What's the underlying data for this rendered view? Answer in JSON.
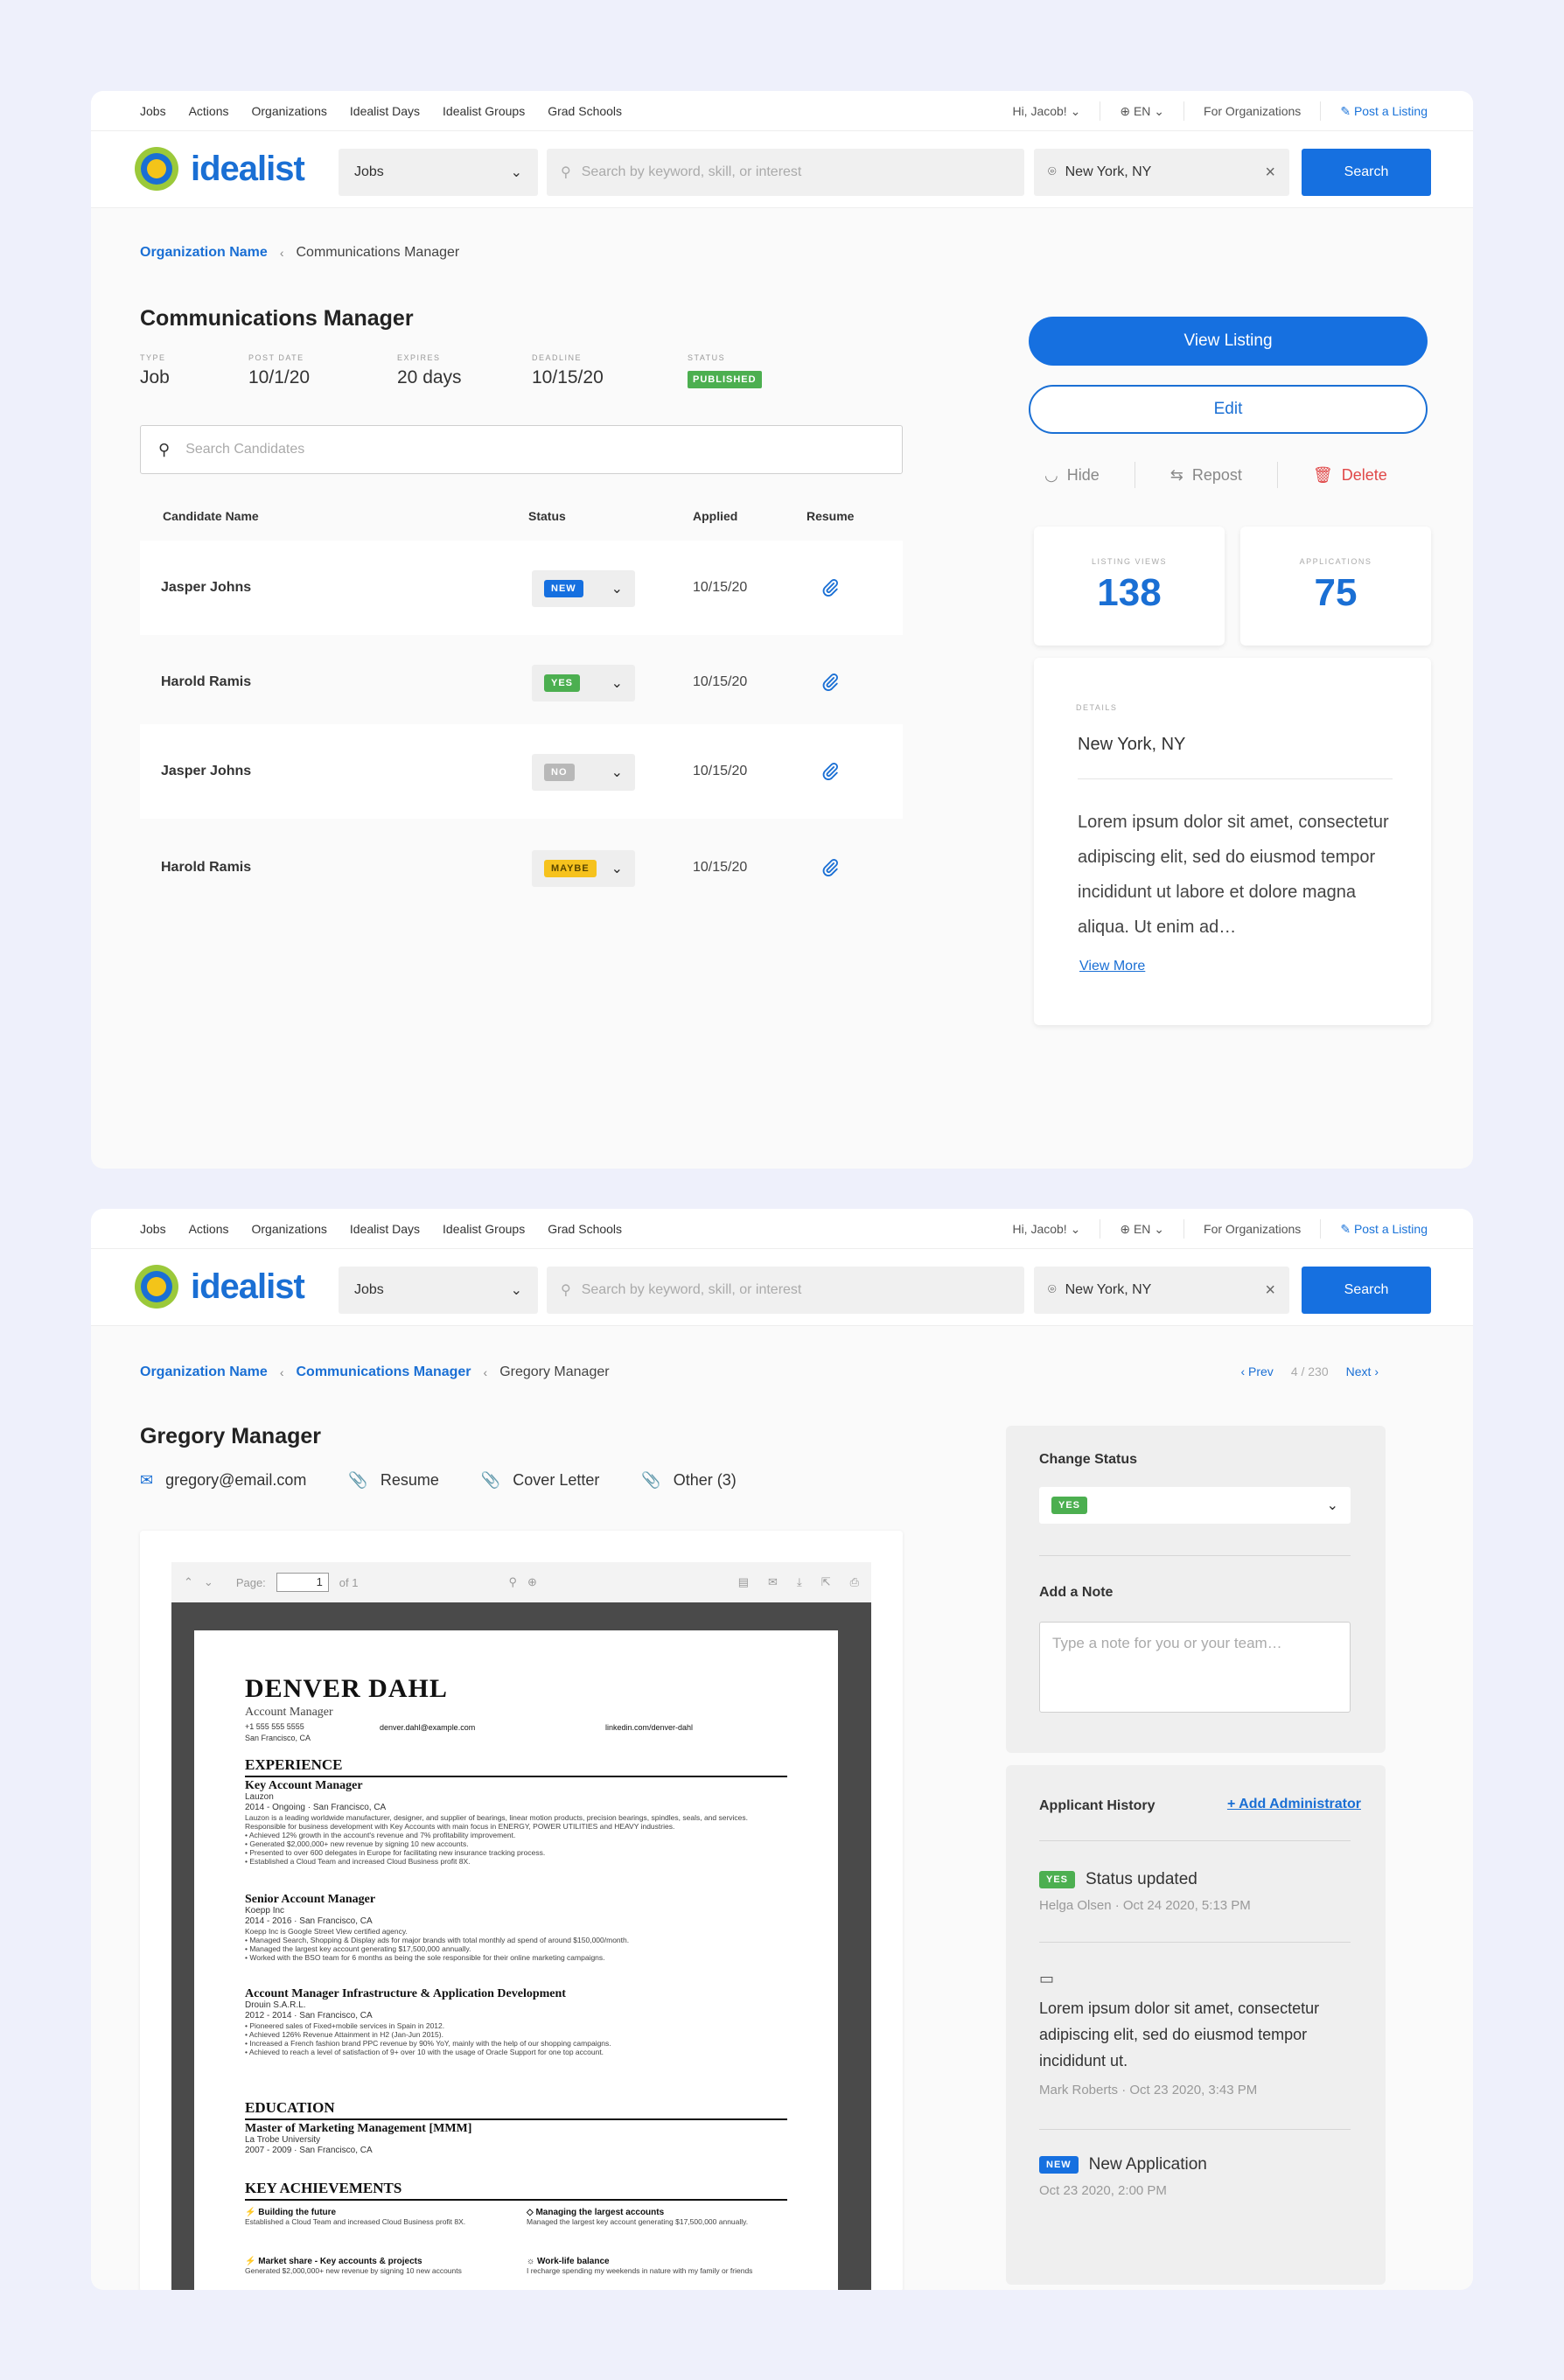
{
  "topnav": {
    "links": [
      "Jobs",
      "Actions",
      "Organizations",
      "Idealist Days",
      "Idealist Groups",
      "Grad Schools"
    ],
    "greeting": "Hi, Jacob!",
    "language": "EN",
    "for_orgs": "For Organizations",
    "post_listing": "Post a Listing"
  },
  "mainbar": {
    "logo": "idealist",
    "job_select": "Jobs",
    "search_placeholder": "Search by keyword, skill, or interest",
    "location": "New York, NY",
    "search_button": "Search"
  },
  "listing": {
    "breadcrumb_org": "Organization Name",
    "breadcrumb_current": "Communications Manager",
    "title": "Communications Manager",
    "meta": [
      {
        "label": "TYPE",
        "value": "Job"
      },
      {
        "label": "POST DATE",
        "value": "10/1/20"
      },
      {
        "label": "EXPIRES",
        "value": "20 days"
      },
      {
        "label": "DEADLINE",
        "value": "10/15/20"
      }
    ],
    "status_label": "STATUS",
    "status_badge": "PUBLISHED",
    "candidate_search_placeholder": "Search Candidates",
    "columns": [
      "Candidate Name",
      "Status",
      "Applied",
      "Resume"
    ],
    "candidates": [
      {
        "name": "Jasper Johns",
        "status": "NEW",
        "applied": "10/15/20"
      },
      {
        "name": "Harold Ramis",
        "status": "YES",
        "applied": "10/15/20"
      },
      {
        "name": "Jasper Johns",
        "status": "NO",
        "applied": "10/15/20"
      },
      {
        "name": "Harold Ramis",
        "status": "MAYBE",
        "applied": "10/15/20"
      }
    ],
    "view_listing": "View Listing",
    "edit": "Edit",
    "hide": "Hide",
    "repost": "Repost",
    "delete": "Delete",
    "listing_views_label": "LISTING VIEWS",
    "listing_views": "138",
    "applications_label": "APPLICATIONS",
    "applications": "75",
    "details_label": "DETAILS",
    "details_location": "New York, NY",
    "details_body": "Lorem ipsum dolor sit amet, consectetur adipiscing elit, sed do eiusmod tempor incididunt ut labore et dolore magna aliqua. Ut enim ad…",
    "view_more": "View More"
  },
  "applicant": {
    "breadcrumb_org": "Organization Name",
    "breadcrumb_job": "Communications Manager",
    "breadcrumb_current": "Gregory Manager",
    "prev": "Prev",
    "counter": "4 / 230",
    "next": "Next",
    "name": "Gregory Manager",
    "email": "gregory@email.com",
    "resume": "Resume",
    "cover_letter": "Cover Letter",
    "other": "Other (3)",
    "viewer": {
      "page_label": "Page:",
      "page_value": "1",
      "page_of": "of 1"
    },
    "resume_doc": {
      "name": "DENVER DAHL",
      "role": "Account Manager",
      "phone": "+1 555 555 5555",
      "city": "San Francisco, CA",
      "email": "denver.dahl@example.com",
      "linkedin": "linkedin.com/denver-dahl",
      "experience_heading": "EXPERIENCE",
      "jobs": [
        {
          "title": "Key Account Manager",
          "company": "Lauzon",
          "dates": "2014 - Ongoing",
          "city": "San Francisco, CA",
          "desc": "Lauzon is a leading worldwide manufacturer, designer, and supplier of bearings, linear motion products, precision bearings, spindles, seals, and services. Responsible for business development with Key Accounts with main focus in ENERGY, POWER UTILITIES and HEAVY industries.",
          "bullets": [
            "Achieved 12% growth in the account's revenue and 7% profitability improvement.",
            "Generated $2,000,000+ new revenue by signing 10 new accounts.",
            "Presented to over 600 delegates in Europe for facilitating new insurance tracking process.",
            "Established a Cloud Team and increased Cloud Business profit 8X."
          ]
        },
        {
          "title": "Senior Account Manager",
          "company": "Koepp Inc",
          "dates": "2014 - 2016",
          "city": "San Francisco, CA",
          "desc": "Koepp Inc is Google Street View certified agency.",
          "bullets": [
            "Managed Search, Shopping & Display ads for major brands with total monthly ad spend of around $150,000/month.",
            "Managed the largest key account generating $17,500,000 annually.",
            "Worked with the BSO team for 6 months as being the sole responsible for their online marketing campaigns."
          ]
        },
        {
          "title": "Account Manager Infrastructure & Application Development",
          "company": "Drouin S.A.R.L.",
          "dates": "2012 - 2014",
          "city": "San Francisco, CA",
          "desc": "",
          "bullets": [
            "Pioneered sales of Fixed+mobile services in Spain in 2012.",
            "Achieved 126% Revenue Attainment in H2 (Jan-Jun 2015).",
            "Increased a French fashion brand PPC revenue by 90% YoY, mainly with the help of our shopping campaigns.",
            "Achieved to reach a level of satisfaction of 9+ over 10 with the usage of Oracle Support for one top account."
          ]
        }
      ],
      "education_heading": "EDUCATION",
      "degree": "Master of Marketing Management [MMM]",
      "school": "La Trobe University",
      "edu_dates": "2007 - 2009",
      "edu_city": "San Francisco, CA",
      "achievements_heading": "KEY ACHIEVEMENTS",
      "achievements": [
        {
          "title": "Building the future",
          "desc": "Established a Cloud Team and increased Cloud Business profit 8X."
        },
        {
          "title": "Managing the largest accounts",
          "desc": "Managed the largest key account generating $17,500,000 annually."
        },
        {
          "title": "Market share - Key accounts & projects",
          "desc": "Generated $2,000,000+ new revenue by signing 10 new accounts"
        },
        {
          "title": "Work-life balance",
          "desc": "I recharge spending my weekends in nature with my family or friends"
        }
      ]
    },
    "change_status_label": "Change Status",
    "current_status": "YES",
    "add_note_label": "Add a Note",
    "note_placeholder": "Type a note for you or your team…",
    "history_label": "Applicant History",
    "add_admin": "+ Add Administrator",
    "history": [
      {
        "badge": "YES",
        "text": "Status updated",
        "meta": "Helga Olsen  ·  Oct 24 2020, 5:13 PM"
      },
      {
        "text": "Lorem ipsum dolor sit amet, consectetur adipiscing elit, sed do eiusmod tempor incididunt ut.",
        "meta": "Mark Roberts  ·  Oct 23 2020, 3:43 PM"
      },
      {
        "badge": "NEW",
        "text": "New Application",
        "meta": "Oct 23 2020, 2:00 PM"
      }
    ]
  },
  "colors": {
    "brand_blue": "#1670e0",
    "yes": "#4caf50",
    "no": "#b8b8b8",
    "maybe": "#f6c21d",
    "delete": "#e04848"
  }
}
